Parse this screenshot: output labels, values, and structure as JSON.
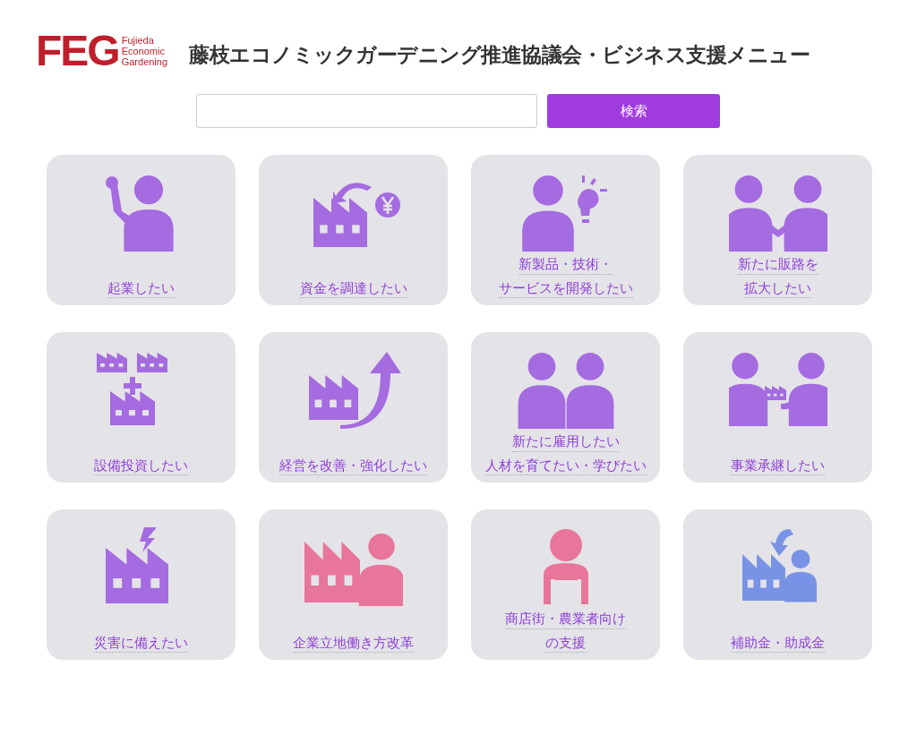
{
  "logo": {
    "mark": "FEG",
    "lines": [
      "Fujieda",
      "Economic",
      "Gardening"
    ]
  },
  "title": "藤枝エコノミックガーデニング推進協議会・ビジネス支援メニュー",
  "search": {
    "button": "検索"
  },
  "menu": [
    {
      "kind": "raised-hand",
      "color": "#a56be0",
      "lines": [
        "起業したい"
      ]
    },
    {
      "kind": "factory-yen",
      "color": "#a56be0",
      "lines": [
        "資金を調達したい"
      ]
    },
    {
      "kind": "person-bulb",
      "color": "#a56be0",
      "lines": [
        "新製品・技術・",
        "サービスを開発したい"
      ]
    },
    {
      "kind": "handshake",
      "color": "#a56be0",
      "lines": [
        "新たに販路を",
        "拡大したい"
      ]
    },
    {
      "kind": "factories-plus",
      "color": "#a56be0",
      "lines": [
        "設備投資したい"
      ]
    },
    {
      "kind": "factory-arrow",
      "color": "#a56be0",
      "lines": [
        "経営を改善・強化したい"
      ]
    },
    {
      "kind": "two-people",
      "color": "#a56be0",
      "lines": [
        "新たに雇用したい",
        "人材を育てたい・学びたい"
      ]
    },
    {
      "kind": "handover",
      "color": "#a56be0",
      "lines": [
        "事業承継したい"
      ]
    },
    {
      "kind": "factory-lightning",
      "color": "#a56be0",
      "lines": [
        "災害に備えたい"
      ]
    },
    {
      "kind": "factory-person",
      "color": "#e8769a",
      "lines": [
        "企業立地働き方改革"
      ]
    },
    {
      "kind": "worker",
      "color": "#e8769a",
      "lines": [
        "商店街・農業者向け",
        "の支援"
      ]
    },
    {
      "kind": "factory-person-arrow",
      "color": "#7893e6",
      "lines": [
        "補助金・助成金"
      ]
    }
  ]
}
